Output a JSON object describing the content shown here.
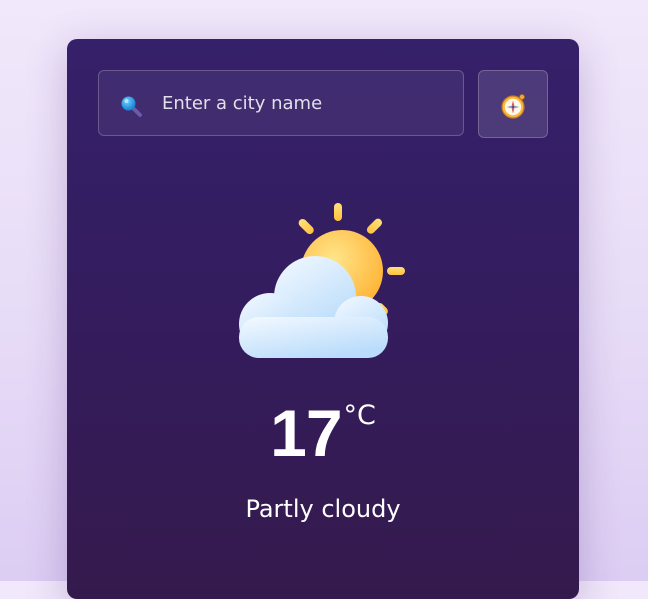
{
  "search": {
    "placeholder": "Enter a city name",
    "value": "",
    "icon": "magnifier-icon"
  },
  "location_button": {
    "icon": "compass-icon"
  },
  "weather": {
    "icon": "partly-cloudy-icon",
    "temperature": "17",
    "unit": "°C",
    "description": "Partly cloudy"
  },
  "colors": {
    "background": "#ebe0f8",
    "card_top": "#35206a",
    "card_bottom": "#341a4c",
    "sun": "#ffc84a",
    "cloud": "#dcecff",
    "text": "#ffffff"
  }
}
